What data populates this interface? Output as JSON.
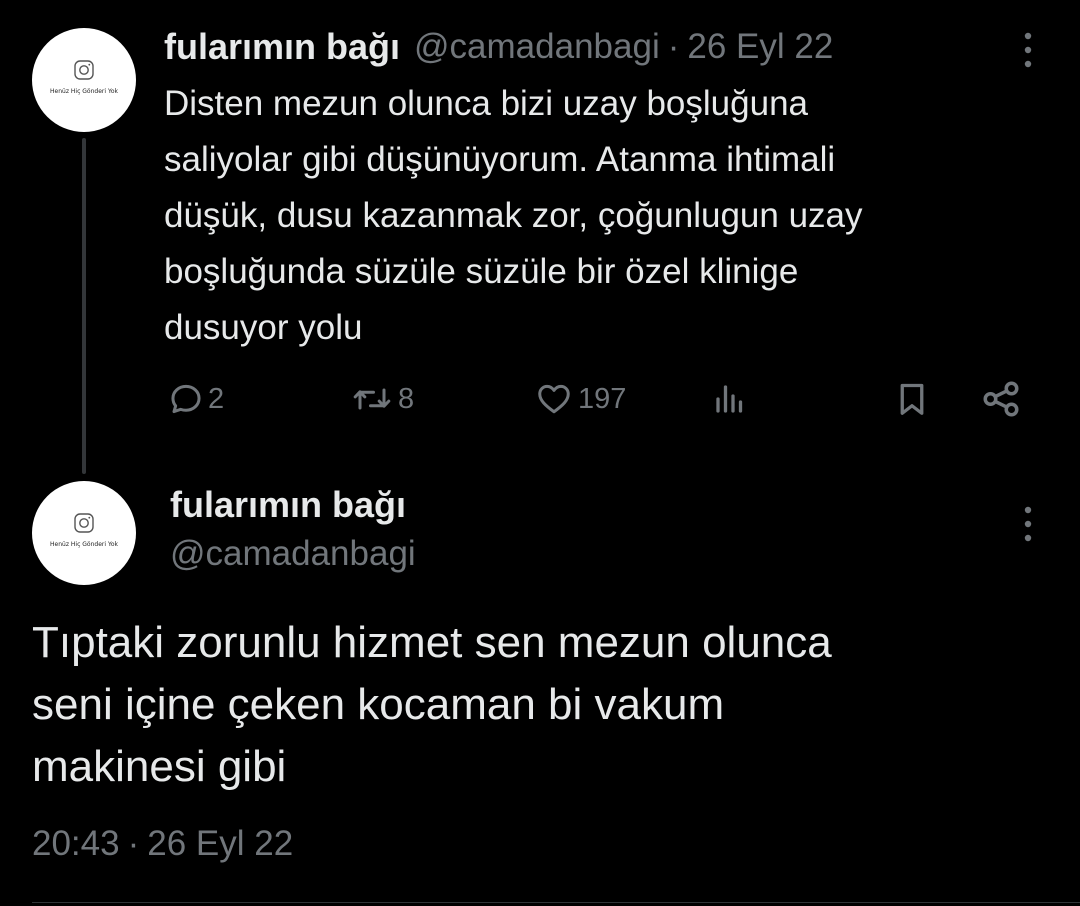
{
  "tweet1": {
    "display_name": "fularımın bağı",
    "handle": "@camadanbagi",
    "separator": "·",
    "date": "26 Eyl 22",
    "text": "Disten mezun olunca bizi uzay boşluğuna\nsaliyolar gibi düşünüyorum. Atanma ihtimali\ndüşük, dusu kazanmak zor, çoğunlugun uzay\nboşluğunda süzüle süzüle bir özel klinige\ndusuyor yolu",
    "avatar_caption": "Henüz Hiç Gönderi Yok",
    "actions": {
      "replies": "2",
      "reposts": "8",
      "likes": "197"
    }
  },
  "tweet2": {
    "display_name": "fularımın bağı",
    "handle": "@camadanbagi",
    "avatar_caption": "Henüz Hiç Gönderi Yok",
    "text": "Tıptaki zorunlu hizmet sen mezun olunca\nseni içine çeken kocaman bi vakum\nmakinesi gibi",
    "time": "20:43",
    "separator": "·",
    "date": "26 Eyl 22"
  },
  "icons": {
    "avatar": "camera-icon",
    "more": "more-vertical-icon",
    "reply": "reply-icon",
    "repost": "repost-icon",
    "like": "heart-icon",
    "views": "views-icon",
    "bookmark": "bookmark-icon",
    "share": "share-icon"
  },
  "colors": {
    "background": "#000000",
    "primary_text": "#e7e9ea",
    "secondary_text": "#71767b",
    "thread_line": "#333639"
  }
}
